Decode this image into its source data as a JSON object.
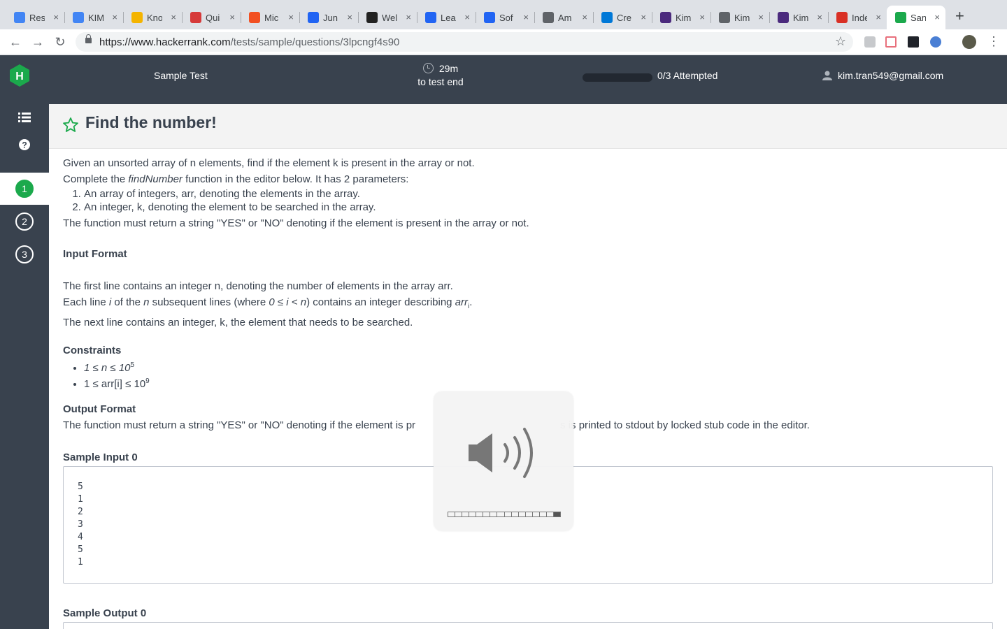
{
  "browser": {
    "tabs": [
      {
        "title": "Res",
        "icon": "google-docs-icon",
        "color": "#4285f4"
      },
      {
        "title": "KIM",
        "icon": "google-docs-icon",
        "color": "#4285f4"
      },
      {
        "title": "Kno",
        "icon": "cake-icon",
        "color": "#f4b400"
      },
      {
        "title": "Qui",
        "icon": "quizlet-icon",
        "color": "#d63a3a"
      },
      {
        "title": "Mic",
        "icon": "microsoft-icon",
        "color": "#f25022"
      },
      {
        "title": "Jun",
        "icon": "indeed-icon",
        "color": "#2164f3"
      },
      {
        "title": "Wel",
        "icon": "amazon-icon",
        "color": "#222"
      },
      {
        "title": "Lea",
        "icon": "indeed-icon",
        "color": "#2164f3"
      },
      {
        "title": "Sof",
        "icon": "indeed-icon",
        "color": "#2164f3"
      },
      {
        "title": "Am",
        "icon": "document-icon",
        "color": "#5f6368"
      },
      {
        "title": "Cre",
        "icon": "vscode-icon",
        "color": "#0078d7"
      },
      {
        "title": "Kim",
        "icon": "circle-app-icon",
        "color": "#4b2a7d"
      },
      {
        "title": "Kim",
        "icon": "document-icon",
        "color": "#5f6368"
      },
      {
        "title": "Kim",
        "icon": "circle-app-icon",
        "color": "#4b2a7d"
      },
      {
        "title": "Inde",
        "icon": "gmail-icon",
        "color": "#d93025"
      },
      {
        "title": "San",
        "icon": "hackerrank-icon",
        "color": "#1ba94c"
      }
    ],
    "url_host": "https://www.hackerrank.com",
    "url_path": "/tests/sample/questions/3lpcngf4s90"
  },
  "header": {
    "test_title": "Sample Test",
    "timer_value": "29m",
    "timer_label": "to test end",
    "attempted": "0/3 Attempted",
    "user_email": "kim.tran549@gmail.com",
    "progress_fraction": 0
  },
  "sidebar": {
    "questions": [
      "1",
      "2",
      "3"
    ],
    "active": "1"
  },
  "question": {
    "title": "Find the number!",
    "intro": "Given an unsorted array of n elements, find if the element k is present in the array or not.",
    "complete_pre": "Complete the ",
    "complete_func": "findNumber",
    "complete_post": " function in the editor below. It has 2 parameters:",
    "params": [
      "An array of integers, arr, denoting the elements in the array.",
      "An integer, k, denoting the element to be searched in the array."
    ],
    "returns": "The function must return a string \"YES\" or \"NO\" denoting if the element is present in the array or not.",
    "input_format_heading": "Input Format",
    "input_line1": "The first line contains an integer n, denoting the number of elements in the array arr.",
    "input_line2_a": "Each line ",
    "input_line2_i": "i",
    "input_line2_b": " of the ",
    "input_line2_n": "n",
    "input_line2_c": " subsequent lines (where ",
    "input_line2_cond": "0 ≤ i < n",
    "input_line2_d": ") contains an integer describing ",
    "input_line2_arr": "arr",
    "input_line2_sub": "i",
    "input_line2_e": ".",
    "input_line3": "The next line contains an integer, k, the element that needs to be searched.",
    "constraints_heading": "Constraints",
    "constraint1": "1 ≤ n ≤ 10",
    "constraint1_sup": "5",
    "constraint2": "1 ≤ arr[i] ≤ 10",
    "constraint2_sup": "9",
    "output_format_heading": "Output Format",
    "output_left": "The function must return a string \"YES\" or \"NO\" denoting if the element is pr",
    "output_right": "s is printed to stdout by locked stub code in the editor.",
    "sample_input_heading": "Sample Input 0",
    "sample_input_lines": [
      "5",
      "1",
      "2",
      "3",
      "4",
      "5",
      "1"
    ],
    "sample_output_heading": "Sample Output 0"
  },
  "volume_hud": {
    "level_fraction": 1.0
  }
}
